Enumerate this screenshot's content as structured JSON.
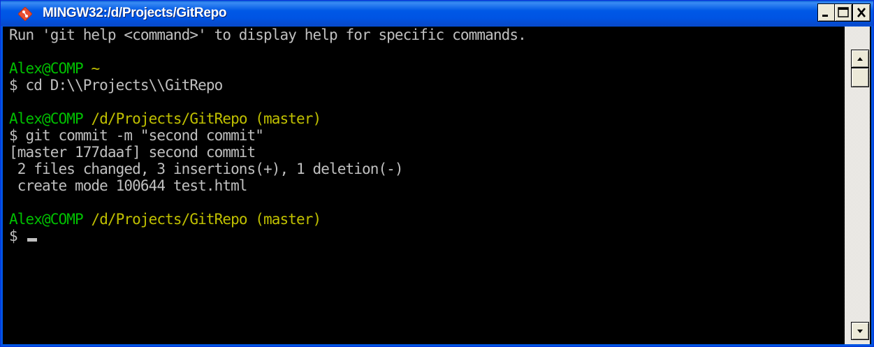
{
  "window": {
    "title": "MINGW32:/d/Projects/GitRepo",
    "app_icon": "git-diamond-icon",
    "buttons": {
      "minimize_icon": "minimize-icon",
      "maximize_icon": "maximize-icon",
      "close_icon": "close-icon"
    }
  },
  "terminal": {
    "colors": {
      "background": "#000000",
      "text": "#c0c0c0",
      "prompt_user": "#00c000",
      "prompt_path": "#c0c000"
    },
    "lines": {
      "l1": "Run 'git help <command>' to display help for specific commands.",
      "l2": "",
      "l3_user": "Alex@COMP",
      "l3_path": " ~",
      "l4": "$ cd D:\\\\Projects\\\\GitRepo",
      "l5": "",
      "l6_user": "Alex@COMP",
      "l6_path": " /d/Projects/GitRepo (master)",
      "l7": "$ git commit -m \"second commit\"",
      "l8": "[master 177daaf] second commit",
      "l9": " 2 files changed, 3 insertions(+), 1 deletion(-)",
      "l10": " create mode 100644 test.html",
      "l11": "",
      "l12_user": "Alex@COMP",
      "l12_path": " /d/Projects/GitRepo (master)",
      "l13": "$ "
    }
  },
  "scrollbar": {
    "up_icon": "arrow-up-icon",
    "down_icon": "arrow-down-icon"
  }
}
